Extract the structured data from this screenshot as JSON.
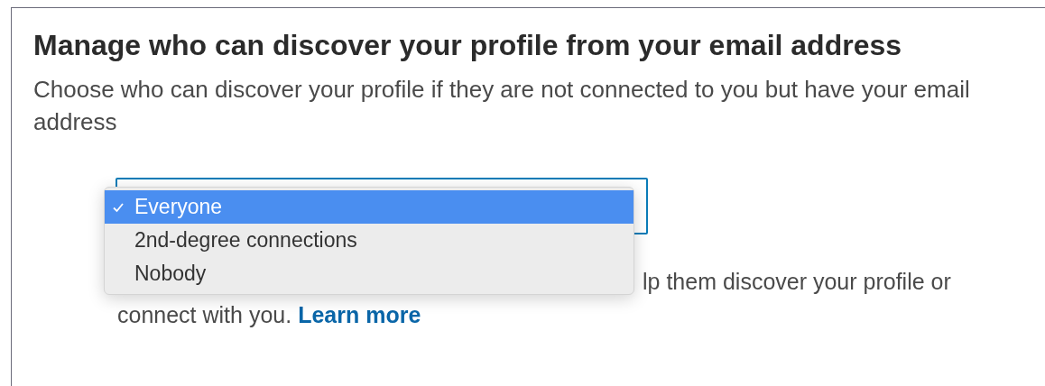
{
  "heading": "Manage who can discover your profile from your email address",
  "description": "Choose who can discover your profile if they are not connected to you but have your email address",
  "dropdown": {
    "options": [
      {
        "label": "Everyone",
        "selected": true
      },
      {
        "label": "2nd-degree connections",
        "selected": false
      },
      {
        "label": "Nobody",
        "selected": false
      }
    ]
  },
  "note": {
    "visible_fragment": "lp them discover your profile or",
    "text": "connect with you.",
    "link": "Learn more"
  }
}
